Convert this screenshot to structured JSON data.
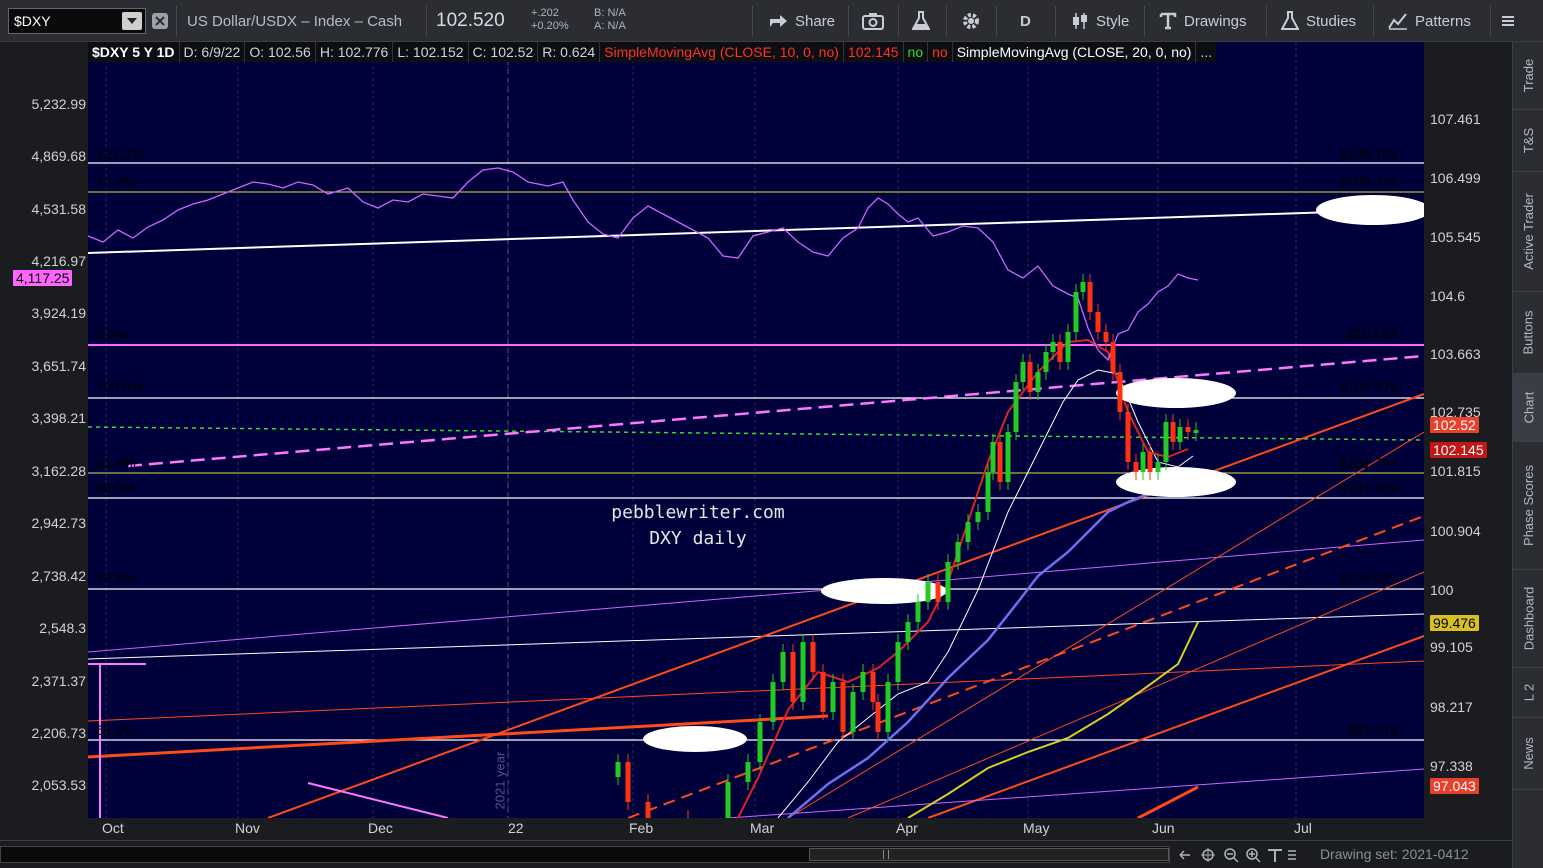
{
  "toolbar": {
    "symbol": "$DXY",
    "instrument": "US Dollar/USDX – Index – Cash",
    "last_price": "102.520",
    "change_abs": "+.202",
    "change_pct": "+0.20%",
    "bid": "B: N/A",
    "ask": "A: N/A",
    "share_label": "Share",
    "aggregation_label": "D",
    "style_label": "Style",
    "drawings_label": "Drawings",
    "studies_label": "Studies",
    "patterns_label": "Patterns"
  },
  "sidebar": {
    "tabs": [
      "Trade",
      "T&S",
      "Active Trader",
      "Buttons",
      "Chart",
      "Phase Scores",
      "Dashboard",
      "L 2",
      "News"
    ]
  },
  "header": {
    "title": "$DXY 5 Y 1D",
    "date": "D: 6/9/22",
    "open": "O: 102.56",
    "high": "H: 102.776",
    "low": "L: 102.152",
    "close": "C: 102.52",
    "range": "R: 0.624",
    "sma10": "SimpleMovingAvg (CLOSE, 10, 0, no)",
    "sma10_val": "102.145",
    "no1": "no",
    "no2": "no",
    "sma20": "SimpleMovingAvg (CLOSE, 20, 0, no)",
    "more": "..."
  },
  "left_axis": {
    "ticks": [
      "5,232.99",
      "4,869.68",
      "4,531.58",
      "4,216.97",
      "3,924.19",
      "3,651.74",
      "3,398.21",
      "3,162.28",
      "2,942.73",
      "2,738.42",
      "2,548.3",
      "2,371.37",
      "2,206.73",
      "2,053.53"
    ],
    "badge": "4,117.25"
  },
  "right_axis": {
    "ticks": [
      "107.461",
      "106.499",
      "105.545",
      "104.6",
      "103.663",
      "102.735",
      "101.815",
      "100.904",
      "100",
      "99.105",
      "98.217",
      "97.338"
    ],
    "badges": {
      "price": "102.52",
      "sma": "102.145",
      "gold": "99.476",
      "low": "97.043"
    }
  },
  "time_axis": {
    "labels": [
      "Oct",
      "Nov",
      "Dec",
      "22",
      "Feb",
      "Mar",
      "Apr",
      "May",
      "Jun",
      "Jul"
    ]
  },
  "fib_levels": [
    {
      "left": "127.2%",
      "right": "$106.724",
      "color": "#ffffff"
    },
    {
      "left": "70.7%",
      "right": "$106.276",
      "color": "#ffff55"
    },
    {
      "left": "0.0%",
      "right": "$103.82",
      "color": "#ff66ff"
    },
    {
      "left": "100.0%",
      "right": "$102.979",
      "color": "#ffffff"
    },
    {
      "left": "61.8%",
      "right": "$101.797",
      "color": "#ffff55"
    },
    {
      "left": "88.6%",
      "right": "$101.409",
      "color": "#ffffff"
    },
    {
      "left": "78.6%",
      "right": "$100.032",
      "color": "#ffffff"
    },
    {
      "left": "61.8%",
      "right": "$97.719",
      "color": "#ffffff"
    }
  ],
  "watermark": {
    "line1": "pebblewriter.com",
    "line2": "DXY daily"
  },
  "vertical_label": "2021 year",
  "status": {
    "drawing_set": "Drawing set: 2021-0412"
  },
  "colors": {
    "plot_bg": "#00003a",
    "up_candle": "#22cc22",
    "down_candle": "#ff3311",
    "spx_line": "#cc66ff",
    "orange": "#ff4a1a"
  }
}
